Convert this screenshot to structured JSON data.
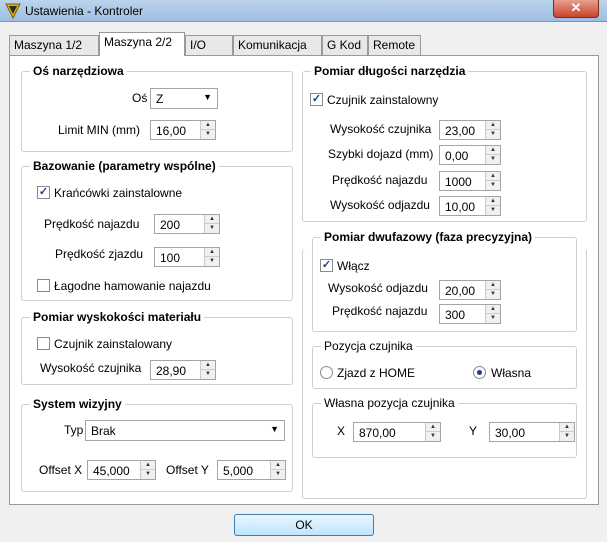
{
  "window": {
    "title": "Ustawienia - Kontroler",
    "close_glyph": "✕"
  },
  "tabs": [
    "Maszyna 1/2",
    "Maszyna 2/2",
    "I/O",
    "Komunikacja",
    "G Kod",
    "Remote"
  ],
  "active_tab": "Maszyna 2/2",
  "tool_axis": {
    "title": "Oś narzędziowa",
    "axis_label": "Oś",
    "axis_value": "Z",
    "limit_label": "Limit MIN (mm)",
    "limit_value": "16,00"
  },
  "homing": {
    "title": "Bazowanie (parametry wspólne)",
    "limit_switches_label": "Krańcówki zainstalowne",
    "limit_switches_checked": true,
    "approach_speed_label": "Prędkość najazdu",
    "approach_speed_value": "200",
    "retract_speed_label": "Prędkość zjazdu",
    "retract_speed_value": "100",
    "soft_braking_label": "Łagodne hamowanie najazdu",
    "soft_braking_checked": false
  },
  "material_height": {
    "title": "Pomiar wyskokości materiału",
    "sensor_installed_label": "Czujnik zainstalowany",
    "sensor_installed_checked": false,
    "sensor_height_label": "Wysokość czujnika",
    "sensor_height_value": "28,90"
  },
  "vision": {
    "title": "System wizyjny",
    "type_label": "Typ",
    "type_value": "Brak",
    "offset_x_label": "Offset X",
    "offset_x_value": "45,000",
    "offset_y_label": "Offset Y",
    "offset_y_value": "5,000"
  },
  "tool_length": {
    "title": "Pomiar długości narzędzia",
    "sensor_installed_label": "Czujnik zainstalowny",
    "sensor_installed_checked": true,
    "sensor_height_label": "Wysokość czujnika",
    "sensor_height_value": "23,00",
    "fast_approach_label": "Szybki dojazd (mm)",
    "fast_approach_value": "0,00",
    "approach_speed_label": "Prędkość najazdu",
    "approach_speed_value": "1000",
    "retract_height_label": "Wysokość odjazdu",
    "retract_height_value": "10,00"
  },
  "two_phase": {
    "title": "Pomiar dwufazowy (faza precyzyjna)",
    "enable_label": "Włącz",
    "enable_checked": true,
    "retract_height_label": "Wysokość odjazdu",
    "retract_height_value": "20,00",
    "approach_speed_label": "Prędkość najazdu",
    "approach_speed_value": "300"
  },
  "sensor_position": {
    "title": "Pozycja czujnika",
    "option_home": "Zjazd z HOME",
    "option_custom": "Własna",
    "selected": "Własna"
  },
  "custom_position": {
    "title": "Własna pozycja czujnika",
    "x_label": "X",
    "x_value": "870,00",
    "y_label": "Y",
    "y_value": "30,00"
  },
  "ok_label": "OK"
}
